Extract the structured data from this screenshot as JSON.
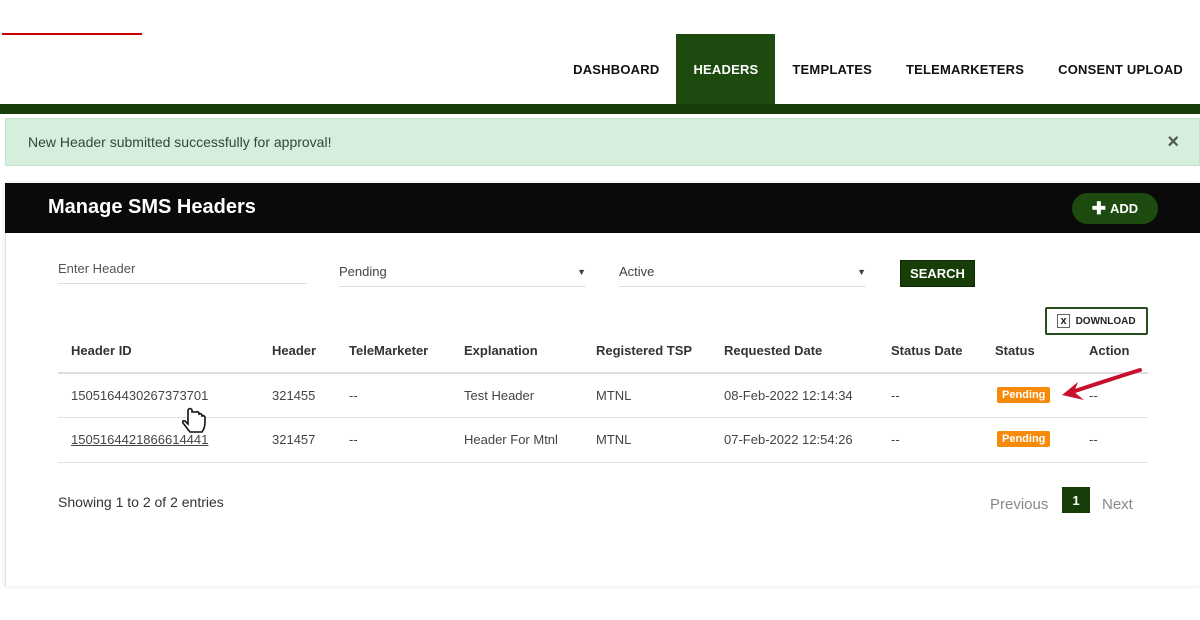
{
  "nav": {
    "items": [
      "DASHBOARD",
      "HEADERS",
      "TEMPLATES",
      "TELEMARKETERS",
      "CONSENT UPLOAD"
    ],
    "active": "HEADERS"
  },
  "alert": {
    "message": "New Header submitted successfully for approval!",
    "close": "×"
  },
  "panel": {
    "title": "Manage SMS Headers",
    "add_label": "ADD",
    "add_icon": "plus-icon"
  },
  "filters": {
    "header_placeholder": "Enter Header",
    "status_value": "Pending",
    "active_value": "Active",
    "search_label": "SEARCH"
  },
  "download_label": "DOWNLOAD",
  "table": {
    "columns": [
      "Header ID",
      "Header",
      "TeleMarketer",
      "Explanation",
      "Registered TSP",
      "Requested Date",
      "Status Date",
      "Status",
      "Action"
    ],
    "rows": [
      [
        "1505164430267373701",
        "321455",
        "--",
        "Test Header",
        "MTNL",
        "08-Feb-2022 12:14:34",
        "--",
        "Pending",
        "--"
      ],
      [
        "1505164421866614441",
        "321457",
        "--",
        "Header For Mtnl",
        "MTNL",
        "07-Feb-2022 12:54:26",
        "--",
        "Pending",
        "--"
      ]
    ]
  },
  "footer": {
    "info": "Showing 1 to 2 of 2 entries",
    "previous": "Previous",
    "page": "1",
    "next": "Next"
  },
  "colors": {
    "brand_green": "#1d4a0f",
    "pending": "#f58a0b",
    "alert_bg": "#d6eedc",
    "annotation_arrow": "#c8102e"
  }
}
